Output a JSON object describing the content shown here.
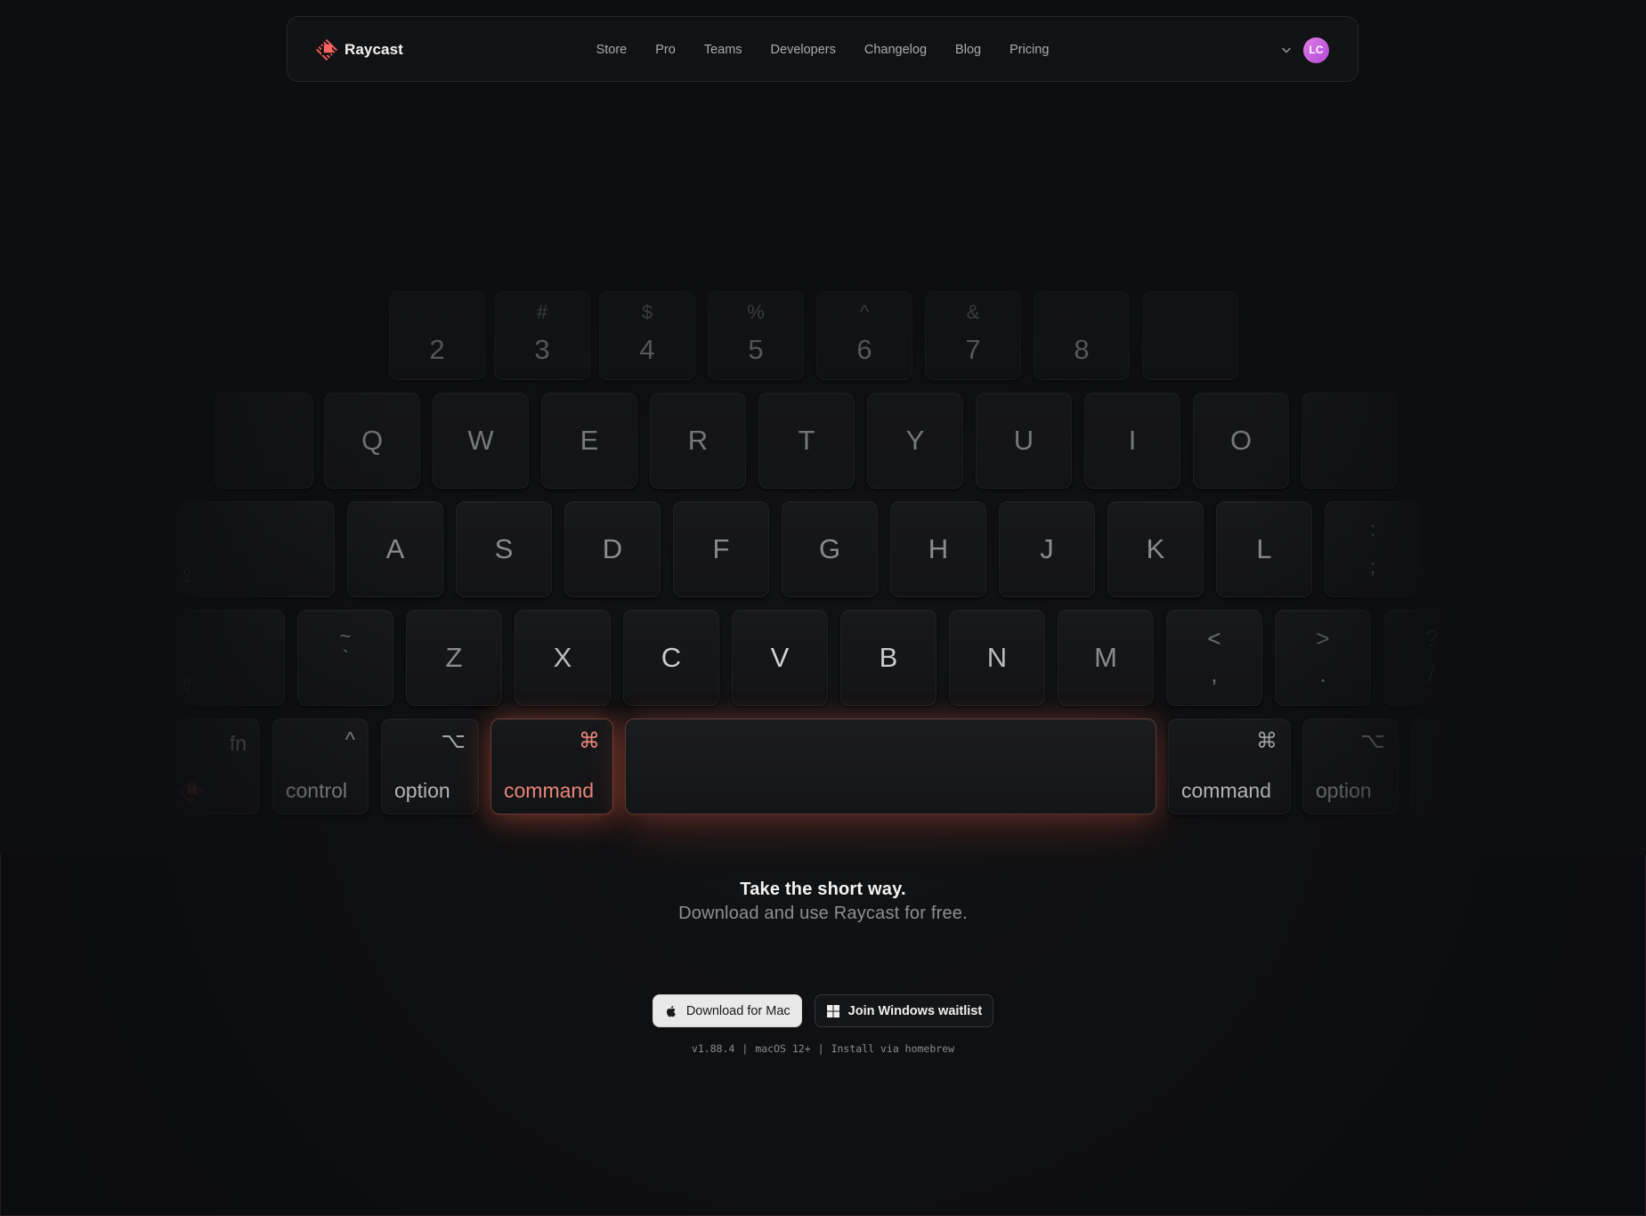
{
  "nav": {
    "brand": "Raycast",
    "links": [
      "Store",
      "Pro",
      "Teams",
      "Developers",
      "Changelog",
      "Blog",
      "Pricing"
    ],
    "avatar_initials": "LC"
  },
  "keyboard": {
    "number_row": [
      {
        "main": "2",
        "sub": ""
      },
      {
        "main": "3",
        "sub": "#"
      },
      {
        "main": "4",
        "sub": "$"
      },
      {
        "main": "5",
        "sub": "%"
      },
      {
        "main": "6",
        "sub": "^"
      },
      {
        "main": "7",
        "sub": "&"
      },
      {
        "main": "8",
        "sub": ""
      },
      {
        "main": "",
        "sub": ""
      }
    ],
    "qwerty_row": [
      "Q",
      "W",
      "E",
      "R",
      "T",
      "Y",
      "U",
      "I",
      "O"
    ],
    "home_row": [
      "A",
      "S",
      "D",
      "F",
      "G",
      "H",
      "J",
      "K",
      "L"
    ],
    "bottom_row": [
      "Z",
      "X",
      "C",
      "V",
      "B",
      "N",
      "M"
    ],
    "tilde": {
      "top": "~",
      "bottom": "`"
    },
    "less": {
      "top": "<",
      "bottom": ","
    },
    "greater": {
      "top": ">",
      "bottom": "."
    },
    "question": {
      "top": "?",
      "bottom": "/"
    },
    "colon": {
      "top": ":",
      "bottom": ";"
    },
    "fn": "fn",
    "control": {
      "glyph": "^",
      "label": "control"
    },
    "option_left": {
      "glyph": "⌥",
      "label": "option"
    },
    "command_left": {
      "glyph": "⌘",
      "label": "command"
    },
    "command_right": {
      "glyph": "⌘",
      "label": "command"
    },
    "option_right": {
      "glyph": "⌥",
      "label": "option"
    }
  },
  "hero": {
    "title": "Take the short way.",
    "subtitle": "Download and use Raycast for free."
  },
  "cta": {
    "mac_label": "Download for Mac",
    "windows_label": "Join Windows waitlist"
  },
  "meta": {
    "version": "v1.88.4",
    "requirement": "macOS 12+",
    "homebrew": "Install via homebrew"
  },
  "colors": {
    "accent": "#ff6363",
    "glow": "#ff6e50",
    "avatar": "#c85ad8"
  }
}
